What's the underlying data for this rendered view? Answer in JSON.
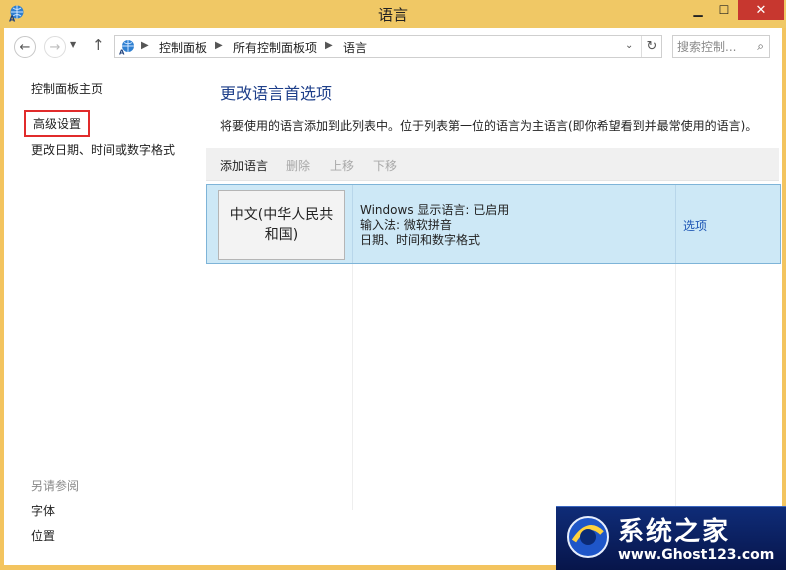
{
  "window": {
    "title": "语言",
    "minimize": "▁",
    "maximize": "☐",
    "close": "✕"
  },
  "nav": {
    "back_icon": "back-arrow",
    "forward_icon": "forward-arrow",
    "up_icon": "up-arrow",
    "breadcrumb": [
      "控制面板",
      "所有控制面板项",
      "语言"
    ],
    "search_placeholder": "搜索控制..."
  },
  "sidebar": {
    "home": "控制面板主页",
    "advanced": "高级设置",
    "change_date": "更改日期、时间或数字格式",
    "see_also": "另请参阅",
    "fonts": "字体",
    "location": "位置"
  },
  "main": {
    "title": "更改语言首选项",
    "description": "将要使用的语言添加到此列表中。位于列表第一位的语言为主语言(即你希望看到并最常使用的语言)。",
    "toolbar": {
      "add": "添加语言",
      "remove": "删除",
      "move_up": "上移",
      "move_down": "下移"
    },
    "languages": [
      {
        "name": "中文(中华人民共和国)",
        "display": "Windows 显示语言: 已启用",
        "input": "输入法: 微软拼音",
        "formats": "日期、时间和数字格式",
        "options": "选项"
      }
    ]
  },
  "watermark": {
    "cn": "系统之家",
    "url": "www.Ghost123.com"
  },
  "colors": {
    "titlebar": "#f0c865",
    "close": "#c7372f",
    "selected_row": "#cde8f6",
    "heading": "#1e3f8a",
    "link": "#1f57b5",
    "highlight_box": "#e12b2b"
  }
}
